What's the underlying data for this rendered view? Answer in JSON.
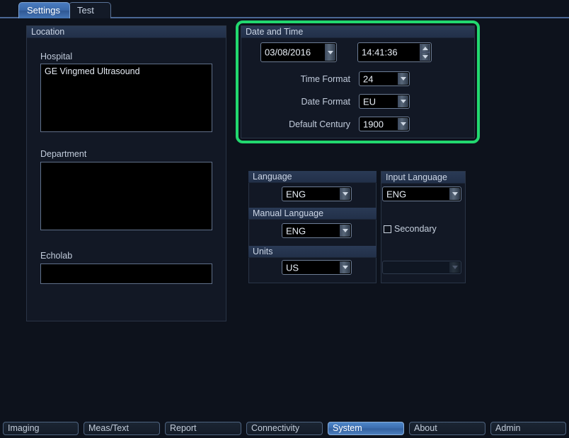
{
  "window": {
    "top_tabs": [
      {
        "label": "Settings",
        "active": true
      },
      {
        "label": "Test",
        "active": false
      }
    ]
  },
  "location_panel": {
    "title": "Location",
    "fields": [
      {
        "label": "Hospital",
        "value": "GE Vingmed Ultrasound"
      },
      {
        "label": "Department",
        "value": ""
      },
      {
        "label": "Echolab",
        "value": ""
      }
    ]
  },
  "date_time_panel": {
    "title": "Date and Time",
    "highlighted": true,
    "highlight_color": "#22d86f",
    "date": {
      "value": "03/08/2016",
      "icon": "chevron-down-icon"
    },
    "time": {
      "value": "14:41:36",
      "icon_up": "chevron-up-icon",
      "icon_down": "chevron-down-icon"
    },
    "rows": [
      {
        "label": "Time Format",
        "value": "24"
      },
      {
        "label": "Date Format",
        "value": "EU"
      },
      {
        "label": "Default Century",
        "value": "1900"
      }
    ]
  },
  "language_panel": {
    "title": "Language",
    "value": "ENG"
  },
  "manual_language_panel": {
    "title": "Manual Language",
    "value": "ENG"
  },
  "units_panel": {
    "title": "Units",
    "value": "US"
  },
  "input_language_panel": {
    "title": "Input Language",
    "value": "ENG",
    "secondary": {
      "label": "Secondary",
      "checked": false
    },
    "secondary_value": ""
  },
  "bottom_tabs": [
    {
      "label": "Imaging",
      "active": false
    },
    {
      "label": "Meas/Text",
      "active": false
    },
    {
      "label": "Report",
      "active": false
    },
    {
      "label": "Connectivity",
      "active": false
    },
    {
      "label": "System",
      "active": true
    },
    {
      "label": "About",
      "active": false
    },
    {
      "label": "Admin",
      "active": false
    }
  ]
}
